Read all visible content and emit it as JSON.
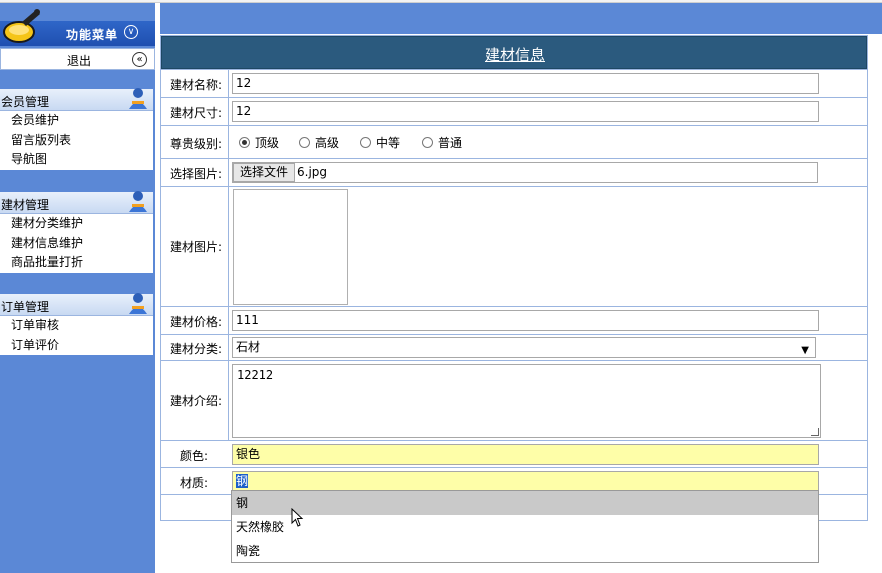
{
  "menu": {
    "title": "功能菜单",
    "logout": "退出"
  },
  "groups": [
    {
      "title": "会员管理",
      "items": [
        "会员维护",
        "留言版列表",
        "导航图"
      ]
    },
    {
      "title": "建材管理",
      "items": [
        "建材分类维护",
        "建材信息维护",
        "商品批量打折"
      ]
    },
    {
      "title": "订单管理",
      "items": [
        "订单审核",
        "订单评价"
      ]
    }
  ],
  "form": {
    "title": "建材信息",
    "labels": {
      "name": "建材名称:",
      "size": "建材尺寸:",
      "level": "尊贵级别:",
      "choose_image": "选择图片:",
      "image": "建材图片:",
      "price": "建材价格:",
      "category": "建材分类:",
      "intro": "建材介绍:",
      "color": "颜色:",
      "material": "材质:"
    },
    "values": {
      "name": "12",
      "size": "12",
      "file_button": "选择文件",
      "file_name": "6.jpg",
      "price": "111",
      "category": "石材",
      "intro": "12212",
      "color": "银色",
      "material": "钢"
    },
    "levels": [
      {
        "label": "顶级",
        "checked": true
      },
      {
        "label": "高级",
        "checked": false
      },
      {
        "label": "中等",
        "checked": false
      },
      {
        "label": "普通",
        "checked": false
      }
    ],
    "material_options": [
      "钢",
      "天然橡胶",
      "陶瓷"
    ]
  },
  "colors": {
    "sidebar": "#5b88d6",
    "form_header": "#2b5a7e",
    "autofill": "#fefea8",
    "selection": "#1d5fc9"
  }
}
